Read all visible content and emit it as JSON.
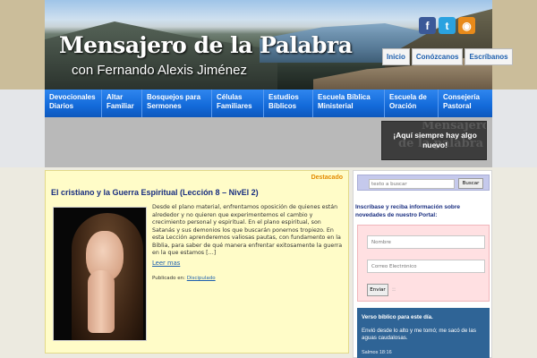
{
  "header": {
    "title": "Mensajero de la Palabra",
    "subtitle": "con Fernando Alexis Jiménez",
    "social": [
      {
        "icon": "facebook-icon",
        "glyph": "f",
        "color": "#3b5998"
      },
      {
        "icon": "twitter-icon",
        "glyph": "t",
        "color": "#2aa2e0"
      },
      {
        "icon": "rss-icon",
        "glyph": "◉",
        "color": "#e88a1a"
      }
    ],
    "topnav": [
      "Inicio",
      "Conózcanos",
      "Escríbanos"
    ]
  },
  "mainnav": [
    [
      "Devocionales",
      "Diarios"
    ],
    [
      "Altar",
      "Familiar"
    ],
    [
      "Bosquejos para",
      "Sermones"
    ],
    [
      "Células",
      "Familiares"
    ],
    [
      "Estudios",
      "Bíblicos"
    ],
    [
      "Escuela Bíblica",
      "Ministerial"
    ],
    [
      "Escuela de",
      "Oración"
    ],
    [
      "Consejería",
      "Pastoral"
    ]
  ],
  "promo": {
    "watermark_1": "Mensajero",
    "watermark_2": "de la palabra",
    "line1": "¡Aquí siempre hay algo",
    "line2": "nuevo!"
  },
  "post": {
    "featured": "Destacado",
    "title": "El cristiano y la Guerra Espiritual (Lección 8 – NivEl 2)",
    "excerpt": "Desde el plano material, enfrentamos oposición de quienes están alrededor y no quieren que experimentemos el cambio y crecimiento personal y espiritual. En el plano espiritual, son Satanás y sus demonios los que buscarán ponernos tropiezo. En esta Lección aprenderemos valiosas pautas, con fundamento en la Biblia, para saber de qué manera enfrentar exitosamente la guerra en la que estamos […]",
    "read_more": "Leer mas",
    "published_label": "Publicado en: ",
    "category": "Discipulado"
  },
  "sidebar": {
    "search_placeholder": "texto a buscar",
    "search_button": "Buscar",
    "subscribe_text": "Inscríbase y reciba información sobre novedades de nuestro Portal:",
    "name_placeholder": "Nombre",
    "email_placeholder": "Correo Electrónico",
    "send_button": "Enviar",
    "send_suffix": "::",
    "verse_title": "Verso bíblico para este día.",
    "verse_text": "Envió desde lo alto y me tomó; me sacó de las aguas caudalosas.",
    "verse_ref": "Salmos 18:16"
  }
}
